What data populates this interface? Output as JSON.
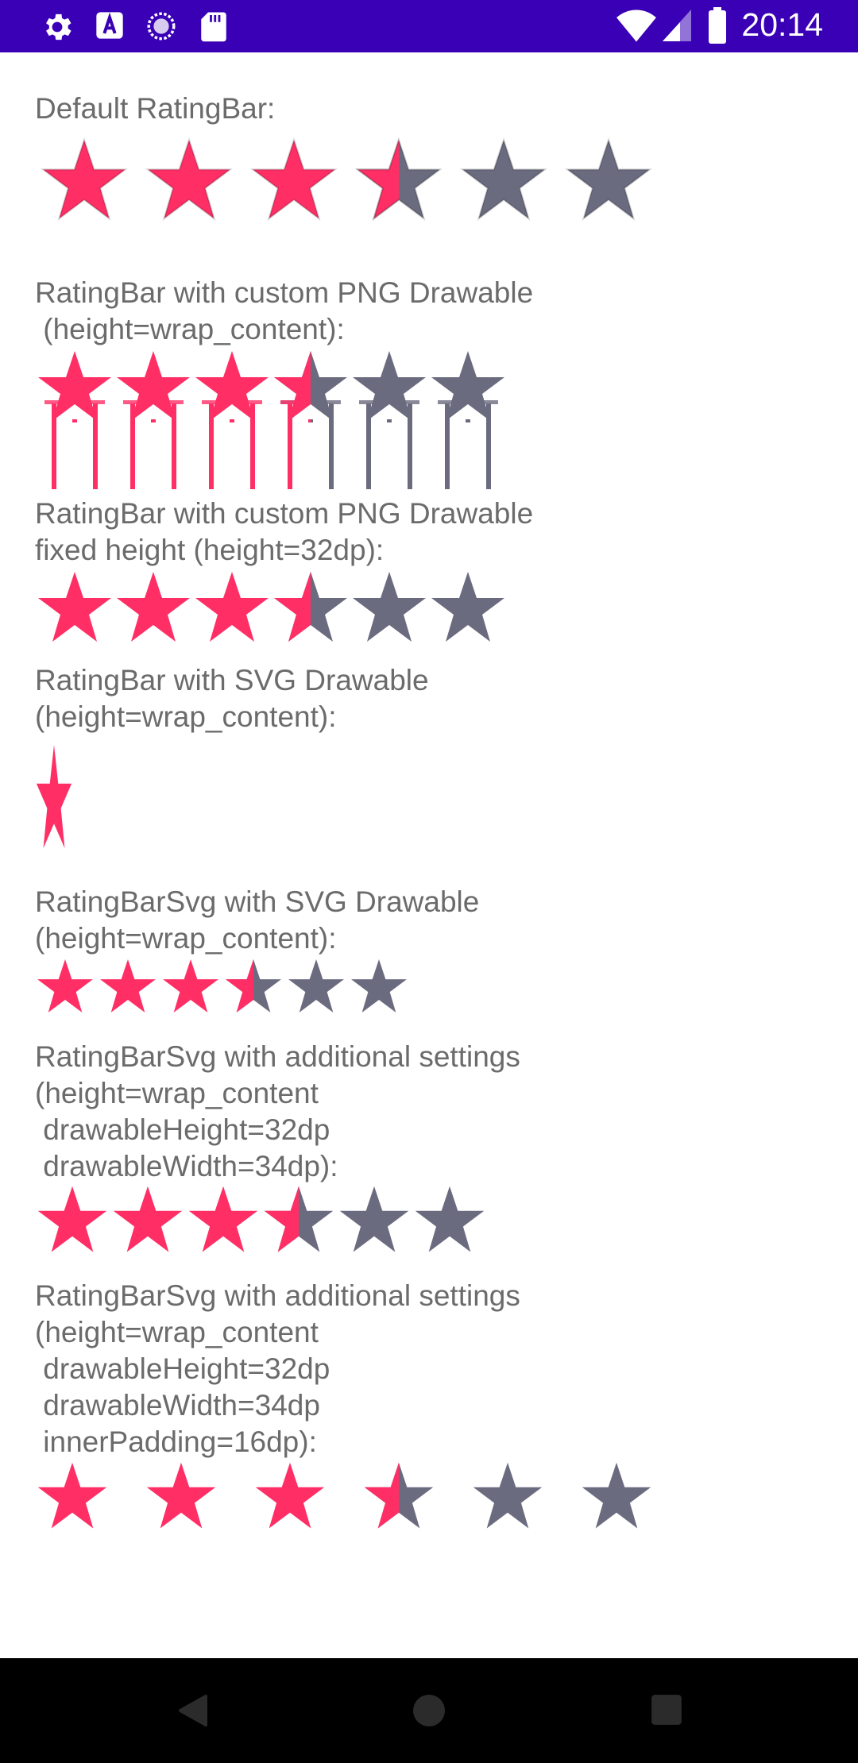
{
  "status_bar": {
    "time": "20:14",
    "left_icons": [
      "gear-icon",
      "a-text-icon",
      "circle-progress-icon",
      "sd-card-icon"
    ],
    "right_icons": [
      "wifi-icon",
      "signal-icon",
      "battery-icon"
    ],
    "background": "#3a00b6"
  },
  "colors": {
    "filled": "#ff2f66",
    "empty": "#6b6b80",
    "label": "#6b6b6b"
  },
  "sections": [
    {
      "label": "Default RatingBar:",
      "rating": 3.5,
      "max": 6
    },
    {
      "label": "RatingBar with custom PNG Drawable\n (height=wrap_content):",
      "rating": 3.5,
      "max": 6
    },
    {
      "label": "RatingBar with custom PNG Drawable\nfixed height (height=32dp):",
      "rating": 3.5,
      "max": 6
    },
    {
      "label": "RatingBar with SVG Drawable\n(height=wrap_content):",
      "rating": 1
    },
    {
      "label": "RatingBarSvg with SVG Drawable\n(height=wrap_content):",
      "rating": 3.5,
      "max": 6
    },
    {
      "label": "RatingBarSvg with additional settings\n(height=wrap_content\n drawableHeight=32dp\n drawableWidth=34dp):",
      "rating": 3.5,
      "max": 6
    },
    {
      "label": "RatingBarSvg with additional settings\n(height=wrap_content\n drawableHeight=32dp\n drawableWidth=34dp\n innerPadding=16dp):",
      "rating": 3.5,
      "max": 6
    }
  ],
  "nav_bar": {
    "buttons": [
      "back-icon",
      "home-icon",
      "recents-icon"
    ]
  }
}
